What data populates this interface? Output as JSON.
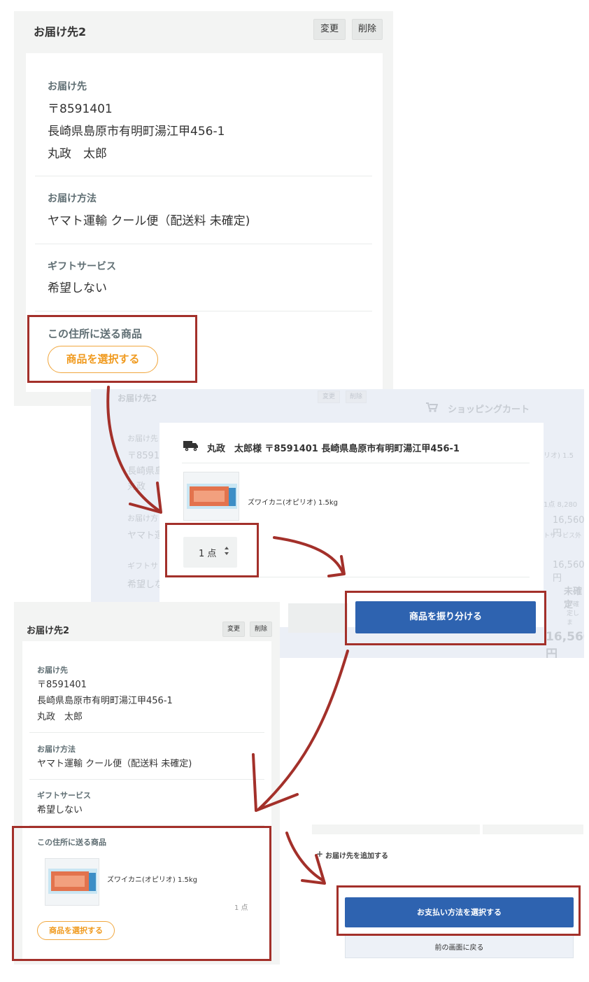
{
  "panel1": {
    "title": "お届け先2",
    "change_label": "変更",
    "delete_label": "削除",
    "destination_label": "お届け先",
    "postal": "〒8591401",
    "address": "長崎県島原市有明町湯江甲456-1",
    "name": "丸政　太郎",
    "delivery_label": "お届け方法",
    "delivery_value": "ヤマト運輸 クール便（配送料 未確定)",
    "gift_label": "ギフトサービス",
    "gift_value": "希望しない",
    "items_label": "この住所に送る商品",
    "select_button": "商品を選択する"
  },
  "panel2": {
    "bg_title": "お届け先2",
    "bg_change": "変更",
    "bg_delete": "削除",
    "bg_cart": "ショッピングカート",
    "bg_left_lines": [
      "お届け先",
      "〒8591",
      "長崎県島",
      "丸政",
      "お届け方",
      "ヤマト運",
      "ギフトサ",
      "希望しな"
    ],
    "bg_right_lines": [
      "リオ) 1.5",
      "1点 8,280",
      "16,560円",
      "トサービス外",
      "16,560円",
      "未確定",
      "が確定しま",
      "16,560円"
    ],
    "recipient": "丸政　太郎様 〒8591401 長崎県島原市有明町湯江甲456-1",
    "product_name": "ズワイカニ(オピリオ) 1.5kg",
    "quantity": "1 点",
    "distribute_button": "商品を振り分ける"
  },
  "panel3": {
    "title": "お届け先2",
    "change_label": "変更",
    "delete_label": "削除",
    "destination_label": "お届け先",
    "postal": "〒8591401",
    "address": "長崎県島原市有明町湯江甲456-1",
    "name": "丸政　太郎",
    "delivery_label": "お届け方法",
    "delivery_value": "ヤマト運輸 クール便（配送料 未確定)",
    "gift_label": "ギフトサービス",
    "gift_value": "希望しない",
    "items_label": "この住所に送る商品",
    "product_name": "ズワイカニ(オピリオ) 1.5kg",
    "quantity": "1 点",
    "select_button": "商品を選択する"
  },
  "panel4": {
    "add_destination": "お届け先を追加する",
    "add_icon": "plus-icon",
    "payment_button": "お支払い方法を選択する",
    "back_button": "前の画面に戻る"
  },
  "colors": {
    "accent_blue": "#2e63b0",
    "accent_orange": "#f09a1e",
    "annotation_red": "#a3302a"
  }
}
